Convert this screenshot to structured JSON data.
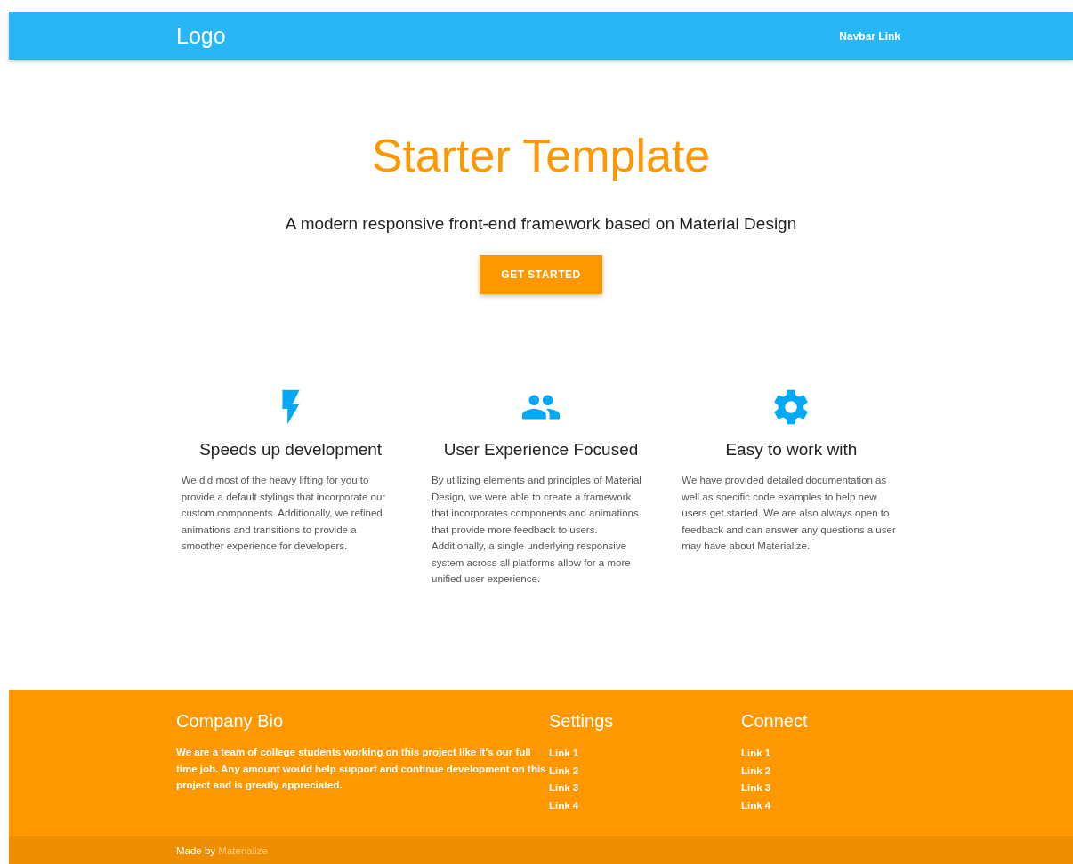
{
  "navbar": {
    "logo": "Logo",
    "links": [
      "Navbar Link"
    ]
  },
  "hero": {
    "title": "Starter Template",
    "subtitle": "A modern responsive front-end framework based on Material Design",
    "button": "GET STARTED"
  },
  "features": [
    {
      "kind": "bolt",
      "title": "Speeds up development",
      "text": "We did most of the heavy lifting for you to provide a default stylings that incorporate our custom components. Additionally, we refined animations and transitions to provide a smoother experience for developers."
    },
    {
      "kind": "group",
      "title": "User Experience Focused",
      "text": "By utilizing elements and principles of Material Design, we were able to create a framework that incorporates components and animations that provide more feedback to users. Additionally, a single underlying responsive system across all platforms allow for a more unified user experience."
    },
    {
      "kind": "gear",
      "title": "Easy to work with",
      "text": "We have provided detailed documentation as well as specific code examples to help new users get started. We are also always open to feedback and can answer any questions a user may have about Materialize."
    }
  ],
  "footer": {
    "bio": {
      "title": "Company Bio",
      "text": "We are a team of college students working on this project like it's our full time job. Any amount would help support and continue development on this project and is greatly appreciated."
    },
    "columns": [
      {
        "title": "Settings",
        "links": [
          "Link 1",
          "Link 2",
          "Link 3",
          "Link 4"
        ]
      },
      {
        "title": "Connect",
        "links": [
          "Link 1",
          "Link 2",
          "Link 3",
          "Link 4"
        ]
      }
    ],
    "credit": {
      "text": "Made by",
      "link": "Materialize"
    }
  }
}
